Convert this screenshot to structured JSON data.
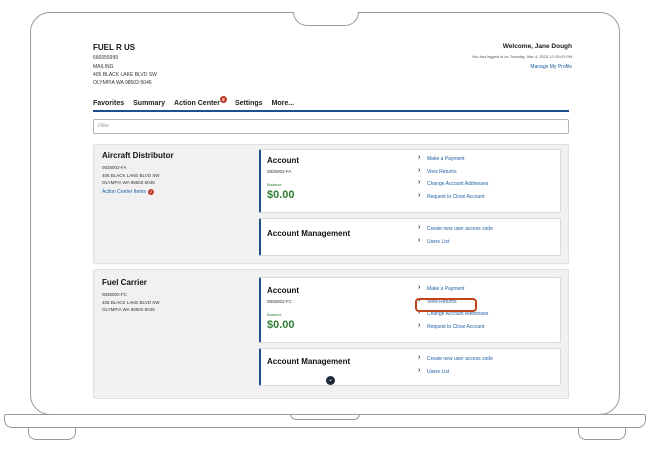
{
  "header": {
    "company": "FUEL R US",
    "account_id": "666555999",
    "address_label": "MAILING",
    "address_line1": "405 BLACK LAKE BLVD SW",
    "address_line2": "OLYMPIA WA 98502-5046",
    "welcome": "Welcome, Jane Dough",
    "last_login": "You last logged in on Tuesday, Mar 4, 2025 12:19:03 PM",
    "manage_profile": "Manage My Profile"
  },
  "nav": {
    "items": [
      "Favorites",
      "Summary",
      "Action Center",
      "Settings",
      "More..."
    ],
    "action_center_badge": "5"
  },
  "filter": {
    "placeholder": "Filter"
  },
  "panels": [
    {
      "name": "Aircraft Distributor",
      "number": "0835002-FA",
      "address_line1": "405 BLACK LAKE BLVD SW",
      "address_line2": "OLYMPIA WA 98502-5046",
      "action_center_link": "Action Center Items",
      "action_center_badge": "2",
      "account": {
        "title": "Account",
        "number": "0835002-FA",
        "balance_label": "Balance",
        "balance": "$0.00",
        "links": [
          "Make a Payment",
          "View Returns",
          "Change Account Addresses",
          "Request to Close Account"
        ]
      },
      "management": {
        "title": "Account Management",
        "links": [
          "Create new user access code",
          "Users List"
        ]
      }
    },
    {
      "name": "Fuel Carrier",
      "number": "0835002-FC",
      "address_line1": "405 BLACK LAKE BLVD SW",
      "address_line2": "OLYMPIA WA 98502-5046",
      "account": {
        "title": "Account",
        "number": "0835002-FC",
        "balance_label": "Balance",
        "balance": "$0.00",
        "links": [
          "Make a Payment",
          "View Returns",
          "Change Account Addresses",
          "Request to Close Account"
        ]
      },
      "management": {
        "title": "Account Management",
        "links": [
          "Create new user access code",
          "Users List"
        ]
      }
    }
  ],
  "colors": {
    "accent": "#1f4f8a",
    "link": "#1f5fa0",
    "balance": "#2e7d32",
    "highlight": "#c2441a",
    "badge": "#c0392b"
  },
  "icons": {
    "scroll": "chevron-down-icon",
    "link_marker": "chevron-right-icon"
  }
}
